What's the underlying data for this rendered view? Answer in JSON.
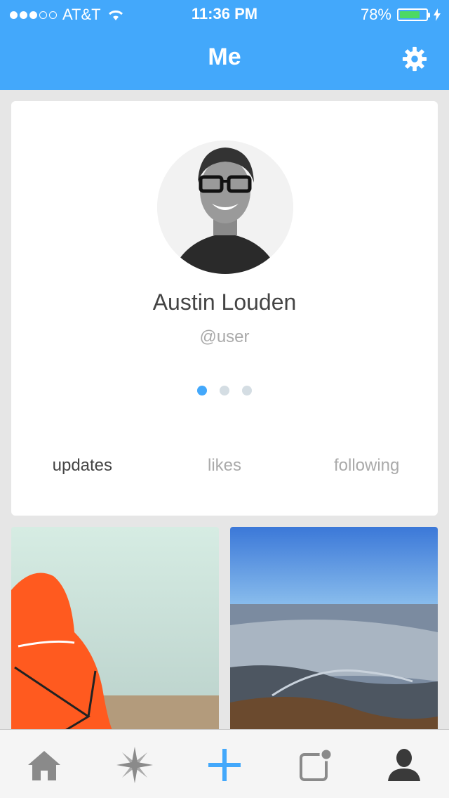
{
  "status_bar": {
    "carrier": "AT&T",
    "time": "11:36 PM",
    "battery_percent": "78%",
    "signal_bars_filled": 3,
    "signal_bars_total": 5
  },
  "nav": {
    "title": "Me",
    "settings_icon": "gear-icon"
  },
  "profile": {
    "name": "Austin Louden",
    "handle": "@user",
    "page_count": 3,
    "active_page": 0
  },
  "tabs": [
    {
      "label": "updates",
      "active": true
    },
    {
      "label": "likes",
      "active": false
    },
    {
      "label": "following",
      "active": false
    }
  ],
  "tab_bar": {
    "items": [
      "home-icon",
      "explore-compass-icon",
      "add-plus-icon",
      "notifications-icon",
      "profile-icon"
    ]
  },
  "colors": {
    "accent": "#43a8fb",
    "background": "#e6e6e6",
    "battery": "#4cd964"
  }
}
